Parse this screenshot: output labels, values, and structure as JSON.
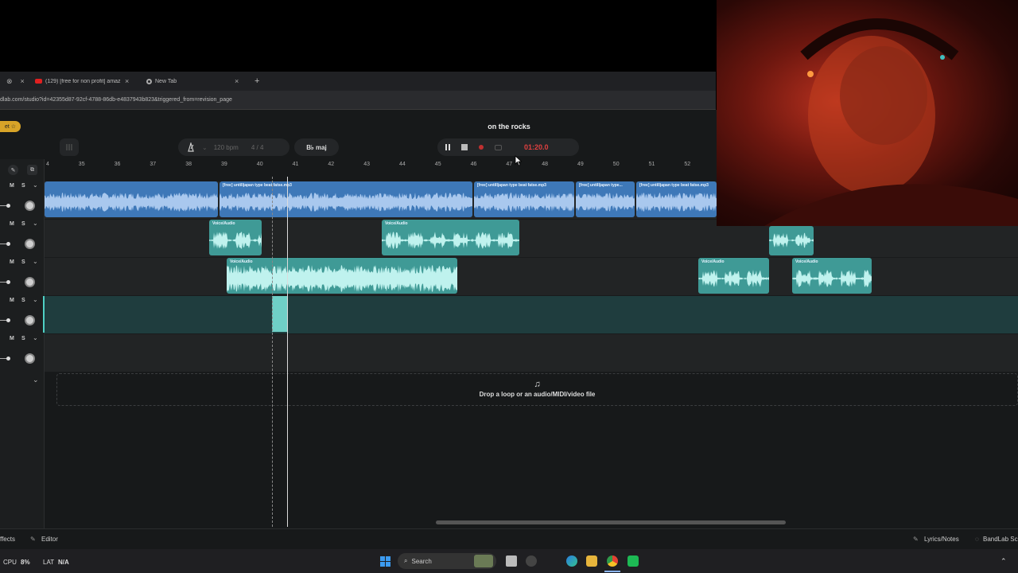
{
  "browser": {
    "tabs": [
      {
        "label": "(129) [free for non profit] amaz",
        "close": "×"
      },
      {
        "label": "New Tab",
        "close": "×"
      }
    ],
    "new_tab": "+",
    "address": "dlab.com/studio?id=42355d87-92cf-4788-86db-e4837943b823&triggered_from=revision_page"
  },
  "studio": {
    "gift_badge": "et ☆",
    "project_title": "on  the rocks",
    "tempo": "120 bpm",
    "time_signature": "4 / 4",
    "key": "B♭ maj",
    "time": "01:20.0",
    "ruler_ticks": [
      "4",
      "35",
      "36",
      "37",
      "38",
      "39",
      "40",
      "41",
      "42",
      "43",
      "44",
      "45",
      "46",
      "47",
      "48",
      "49",
      "50",
      "51",
      "52"
    ],
    "track_controls": {
      "mute": "M",
      "solo": "S"
    },
    "clips": {
      "beat1": "[free] untilljapan type beat fatse.mp3",
      "beat2": "[free] untilljapan type beat fatse.mp3",
      "beat3": "[free] untilljapan type...",
      "beat4": "[free] untilljapan type beat fatse.mp3",
      "voice": "Voice/Audio"
    },
    "drop_zone": "Drop a loop or an audio/MIDI/video file",
    "drop_icon": "♫"
  },
  "bottom_bar": {
    "effects": "ffects",
    "editor": "Editor",
    "lyrics": "Lyrics/Notes",
    "bandlab": "BandLab Sc"
  },
  "taskbar": {
    "cpu_label": "CPU",
    "cpu_value": "8%",
    "lat_label": "LAT",
    "lat_value": "N/A",
    "search": "Search"
  },
  "colors": {
    "beat_clip": "#3e78b8",
    "voice_clip": "#3f9a96",
    "record": "#e04040"
  }
}
